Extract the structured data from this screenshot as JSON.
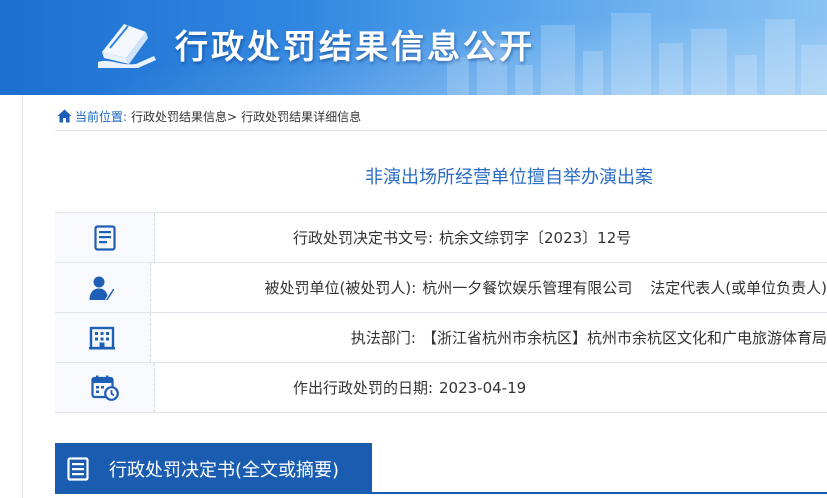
{
  "banner": {
    "title": "行政处罚结果信息公开",
    "logo_icon": "book-hand-icon"
  },
  "breadcrumb": {
    "icon": "home-icon",
    "label": "当前位置:",
    "item1": "行政处罚结果信息>",
    "item2": "行政处罚结果详细信息"
  },
  "case": {
    "title": "非演出场所经营单位擅自举办演出案"
  },
  "info": {
    "rows": [
      {
        "icon": "document-list-icon",
        "label": "行政处罚决定书文号:",
        "value": "杭余文综罚字〔2023〕12号",
        "extra": ""
      },
      {
        "icon": "person-pen-icon",
        "label": "被处罚单位(被处罚人):",
        "value": "杭州一夕餐饮娱乐管理有限公司",
        "extra": "法定代表人(或单位负责人)"
      },
      {
        "icon": "building-icon",
        "label": "执法部门:",
        "value": "【浙江省杭州市余杭区】杭州市余杭区文化和广电旅游体育局",
        "extra": ""
      },
      {
        "icon": "calendar-clock-icon",
        "label": "作出行政处罚的日期:",
        "value": "2023-04-19",
        "extra": ""
      }
    ]
  },
  "section": {
    "icon": "document-icon",
    "title": "行政处罚决定书(全文或摘要)"
  },
  "colors": {
    "brand_blue": "#1a5cb0",
    "title_blue": "#2b6cc4",
    "icon_blue": "#1e5eb5"
  }
}
